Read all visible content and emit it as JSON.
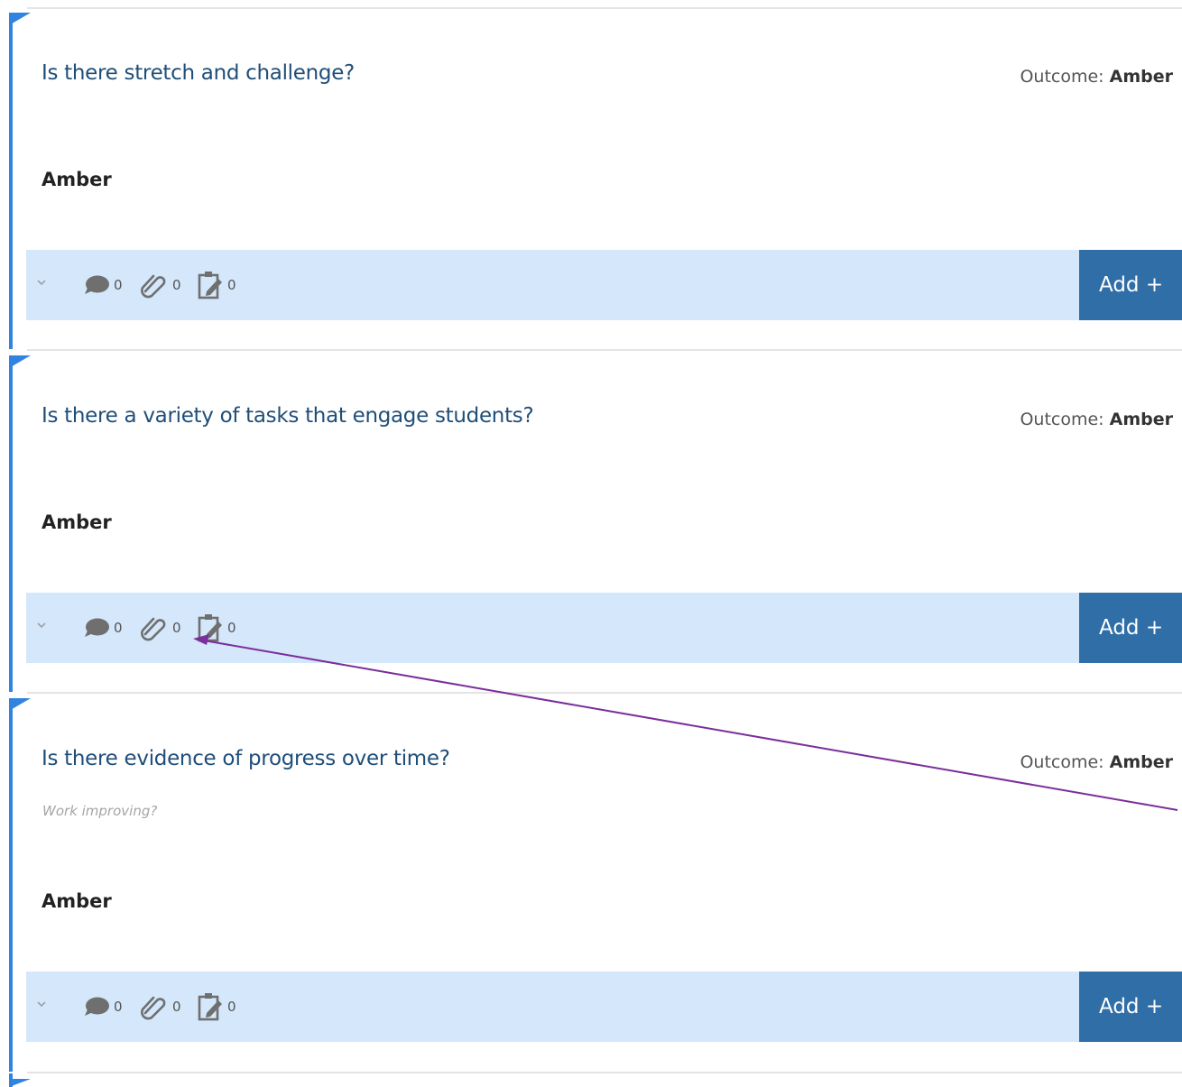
{
  "criteria": [
    {
      "question": "Is there stretch and challenge?",
      "hint": "",
      "outcome_label": "Outcome:",
      "outcome_value": "Amber",
      "answer": "Amber",
      "comments_count": "0",
      "attachments_count": "0",
      "tasks_count": "0",
      "add_label": "Add +"
    },
    {
      "question": "Is there a variety of tasks that engage students?",
      "hint": "",
      "outcome_label": "Outcome:",
      "outcome_value": "Amber",
      "answer": "Amber",
      "comments_count": "0",
      "attachments_count": "0",
      "tasks_count": "0",
      "add_label": "Add +"
    },
    {
      "question": "Is there evidence of progress over time?",
      "hint": "Work improving?",
      "outcome_label": "Outcome:",
      "outcome_value": "Amber",
      "answer": "Amber",
      "comments_count": "0",
      "attachments_count": "0",
      "tasks_count": "0",
      "add_label": "Add +"
    }
  ],
  "icons": {
    "expand": "chevron-down-icon",
    "comments": "speech-bubble-icon",
    "attachments": "paperclip-icon",
    "tasks": "clipboard-edit-icon"
  },
  "colors": {
    "accent_bar": "#3183e0",
    "question_text": "#1f4e79",
    "toolbar_bg": "#d4e7fb",
    "add_button": "#2f6ea7",
    "annotation_arrow": "#7a2f9a"
  }
}
